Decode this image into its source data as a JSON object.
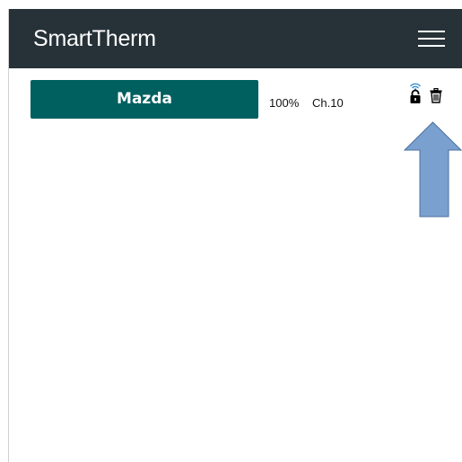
{
  "app": {
    "title": "SmartTherm"
  },
  "header": {
    "background": "#263238",
    "menu_icon": "hamburger-menu-icon"
  },
  "device_list": [
    {
      "name": "Mazda",
      "level": "100%",
      "channel": "Ch.10",
      "color": "#005f5f",
      "icons": [
        "wifi-signal-icon",
        "lock-icon",
        "trash-icon"
      ]
    }
  ],
  "annotation": {
    "arrow_color": "#7aa0d0",
    "arrow_icon": "up-arrow-annotation"
  }
}
